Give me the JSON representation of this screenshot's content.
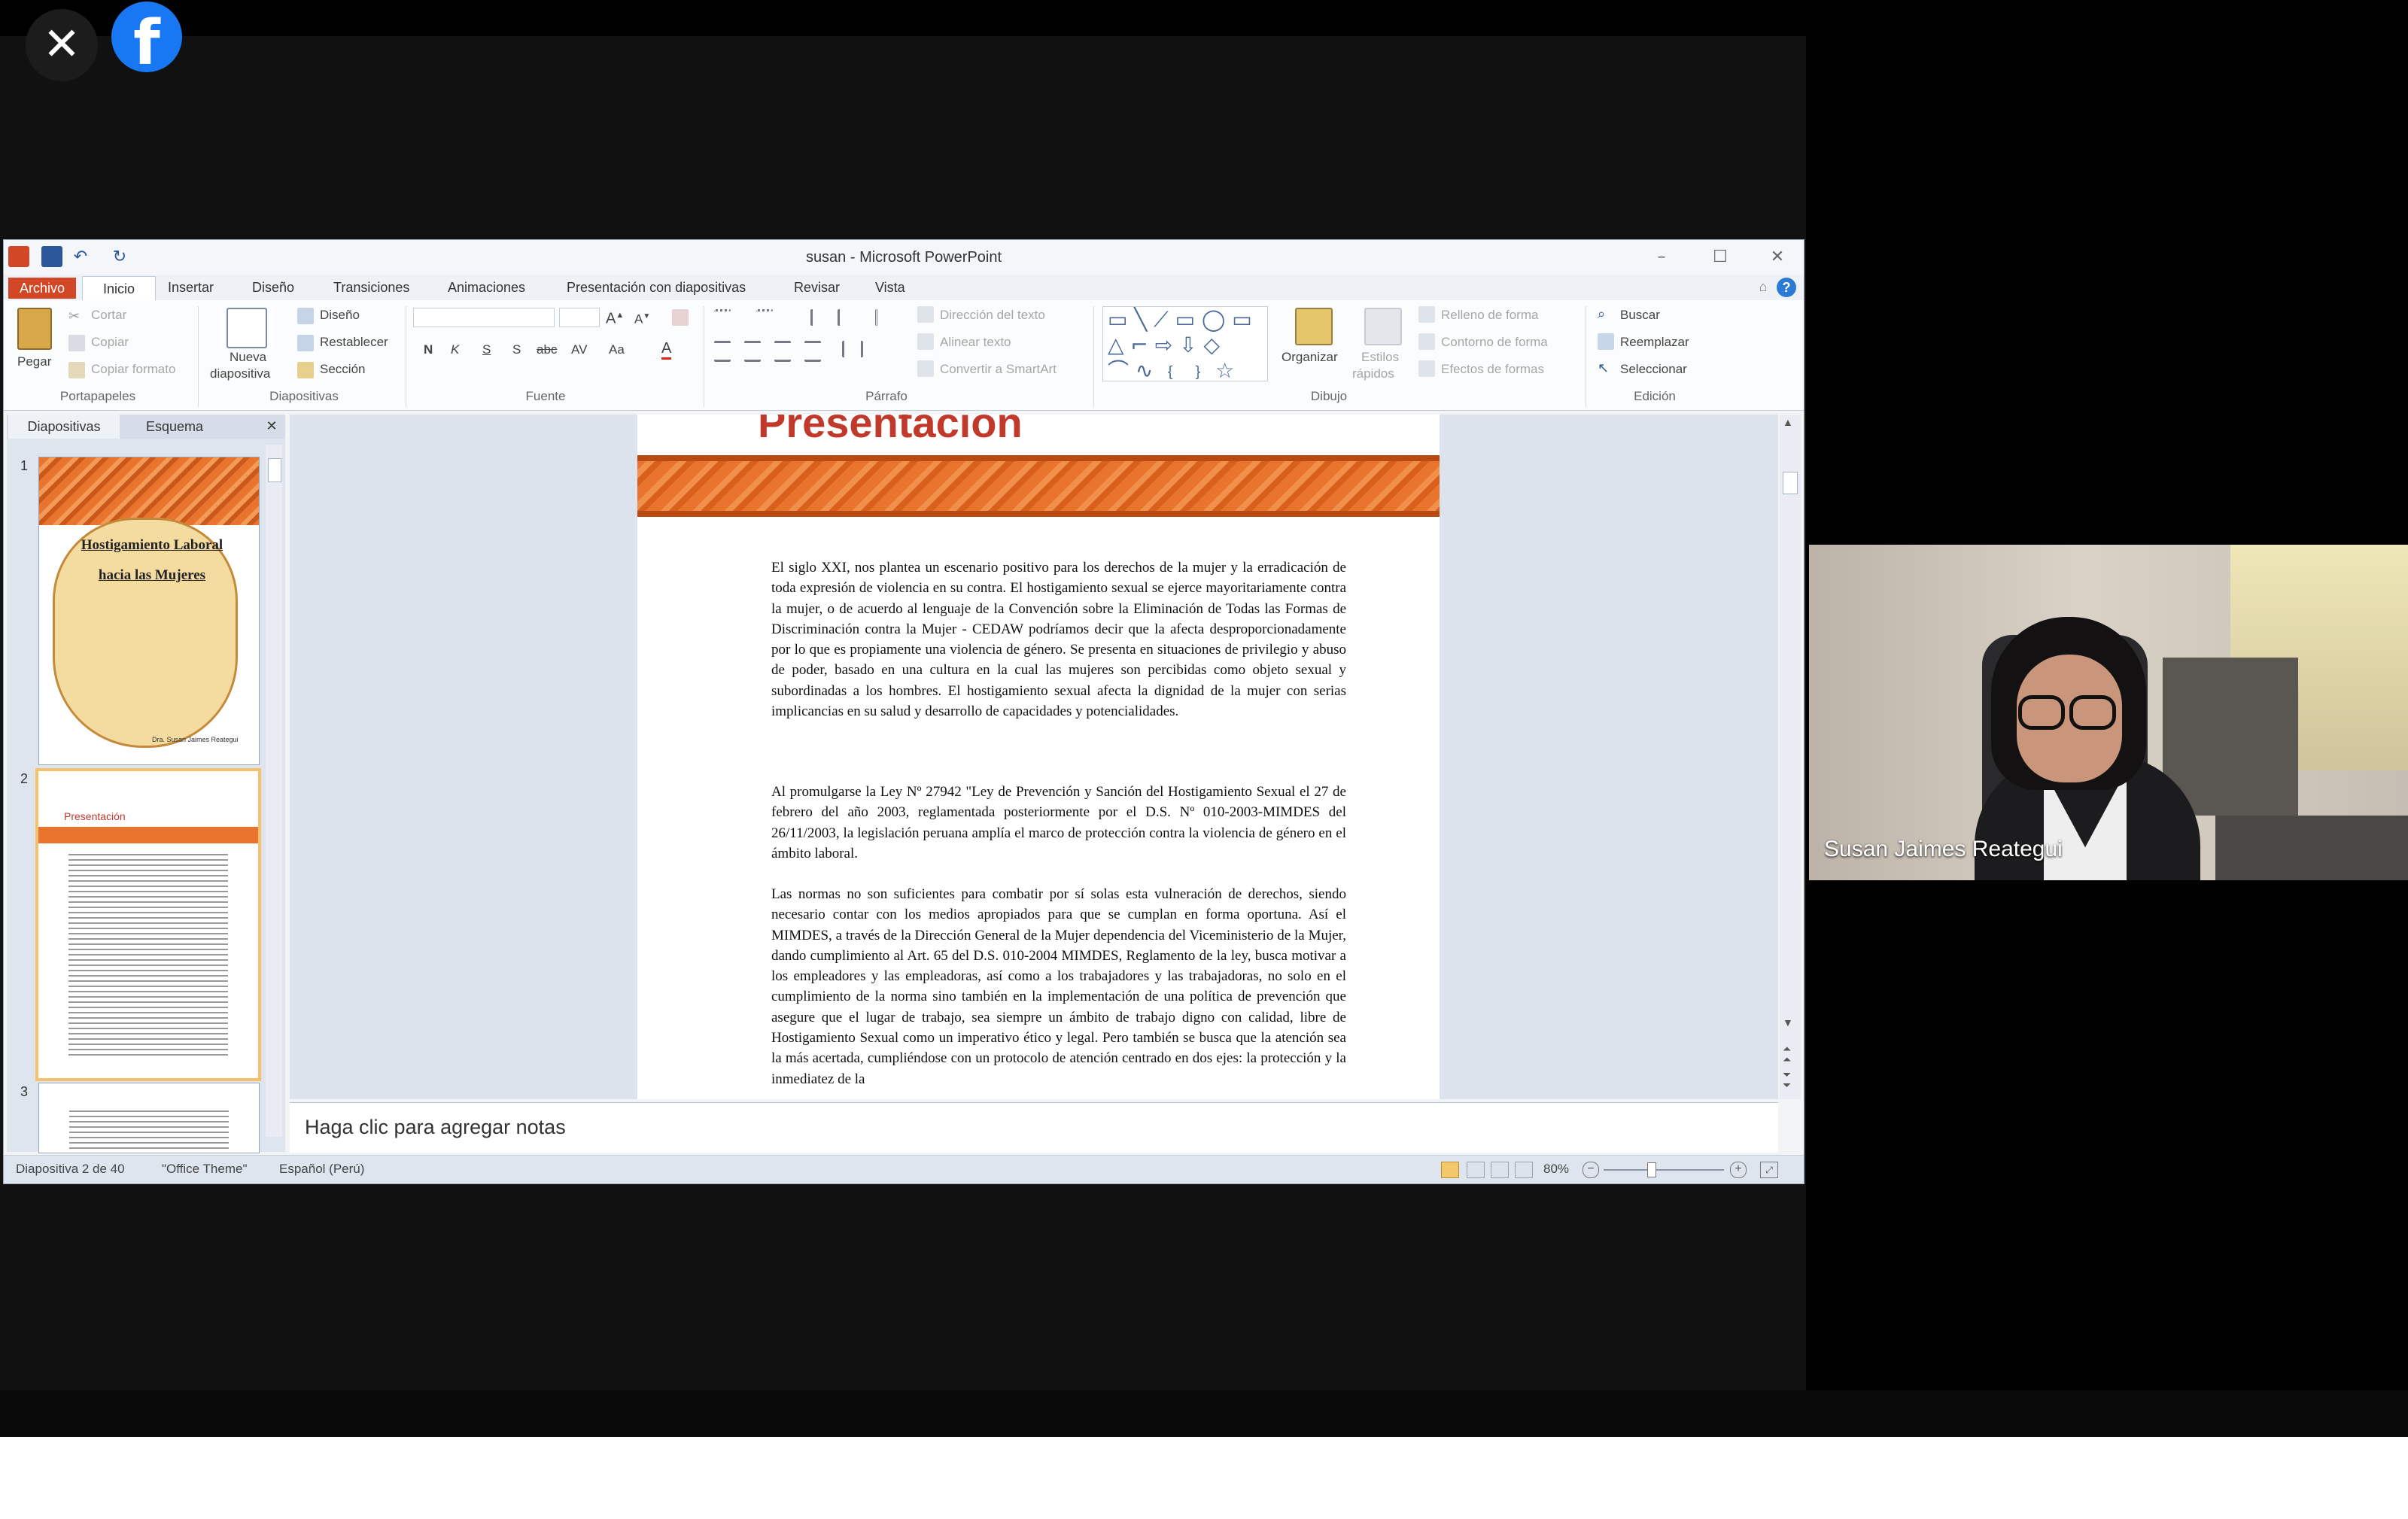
{
  "window": {
    "title": "susan - Microsoft PowerPoint"
  },
  "tabs": [
    "Archivo",
    "Inicio",
    "Insertar",
    "Diseño",
    "Transiciones",
    "Animaciones",
    "Presentación con diapositivas",
    "Revisar",
    "Vista"
  ],
  "ribbon": {
    "portapapeles": {
      "paste": "Pegar",
      "cut": "Cortar",
      "copy": "Copiar",
      "format_painter": "Copiar formato",
      "label": "Portapapeles"
    },
    "diapositivas": {
      "new_slide_1": "Nueva",
      "new_slide_2": "diapositiva",
      "layout": "Diseño",
      "reset": "Restablecer",
      "section": "Sección",
      "label": "Diapositivas"
    },
    "fuente": {
      "bold": "N",
      "italic": "K",
      "underline": "S",
      "shadow": "S",
      "strike": "abc",
      "spacing": "AV",
      "case": "Aa",
      "color": "A",
      "label": "Fuente"
    },
    "parrafo": {
      "text_direction": "Dirección del texto",
      "align_text": "Alinear texto",
      "smartart": "Convertir a SmartArt",
      "label": "Párrafo"
    },
    "dibujo": {
      "arrange": "Organizar",
      "quick_styles_1": "Estilos",
      "quick_styles_2": "rápidos",
      "fill": "Relleno de forma",
      "outline": "Contorno de forma",
      "effects": "Efectos de formas",
      "label": "Dibujo"
    },
    "edicion": {
      "find": "Buscar",
      "replace": "Reemplazar",
      "select": "Seleccionar",
      "label": "Edición"
    }
  },
  "pane": {
    "tab_slides": "Diapositivas",
    "tab_outline": "Esquema",
    "thumb_nums": [
      "1",
      "2",
      "3"
    ],
    "thumb1_title_1": "Hostigamiento Laboral",
    "thumb1_title_2": "hacia las Mujeres",
    "thumb1_author": "Dra. Susan Jaimes Reategui",
    "thumb2_title": "Presentación"
  },
  "slide": {
    "title": "Presentación",
    "paragraphs": [
      "El siglo XXI, nos plantea un escenario positivo para los derechos de la mujer y la erradicación de toda expresión de violencia en su contra. El hostigamiento sexual se ejerce mayoritariamente contra la mujer, o de acuerdo al lenguaje de la Convención sobre la Eliminación de Todas las Formas de Discriminación contra la Mujer - CEDAW podríamos decir que la afecta desproporcionadamente por lo que es propiamente una violencia de género. Se presenta en situaciones de privilegio y abuso de poder, basado en una cultura en la cual las mujeres son percibidas como objeto sexual y subordinadas a los hombres. El hostigamiento sexual afecta la dignidad de la mujer con serias implicancias en su salud y desarrollo de capacidades y potencialidades.",
      "Al promulgarse la Ley Nº 27942 \"Ley de Prevención y Sanción del Hostigamiento Sexual el 27 de febrero del año 2003, reglamentada posteriormente por el D.S. Nº 010-2003-MIMDES del 26/11/2003, la legislación peruana amplía el marco de protección contra la violencia de género en el ámbito laboral.",
      "Las normas no son suficientes para combatir por sí solas esta vulneración de derechos, siendo necesario contar con los medios apropiados para que se cumplan en forma oportuna. Así el MIMDES, a través de la Dirección General de la Mujer dependencia del Viceministerio de la Mujer, dando cumplimiento al Art. 65 del D.S. 010-2004 MIMDES, Reglamento de la ley, busca motivar a los empleadores y las empleadoras, así como a los trabajadores y las trabajadoras, no solo en el cumplimiento de la norma sino también en la implementación de una política de prevención que asegure que el lugar de trabajo, sea siempre un ámbito de trabajo digno con calidad, libre de Hostigamiento Sexual como un imperativo ético y legal. Pero también se busca que la atención sea la más acertada, cumpliéndose con un protocolo de atención centrado en dos ejes: la protección y la inmediatez de la"
    ]
  },
  "notes": {
    "placeholder": "Haga clic para agregar notas"
  },
  "status": {
    "slide": "Diapositiva 2 de 40",
    "theme": "\"Office Theme\"",
    "language": "Español (Perú)",
    "zoom": "80%"
  },
  "participant": {
    "name": "Susan Jaimes Reategui"
  },
  "colors": {
    "accent": "#d24726",
    "facebook": "#1877f2",
    "band": "#e8742e"
  },
  "icons": [
    "close-icon",
    "facebook-logo-icon",
    "save-icon",
    "undo-icon",
    "redo-icon",
    "help-icon"
  ]
}
